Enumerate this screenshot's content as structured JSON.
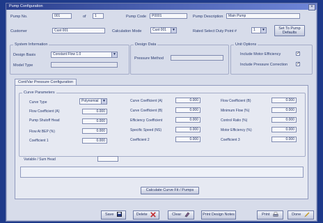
{
  "window": {
    "title": "Pump Configuration",
    "close_glyph": "×"
  },
  "header": {
    "pump_no_label": "Pump No.",
    "pump_no_value": "001",
    "of_label": "of",
    "of_value": "1",
    "pump_code_label": "Pump Code",
    "pump_code_value": "P0001",
    "pump_desc_label": "Pump Description",
    "pump_desc_value": "Main Pump",
    "customer_label": "Customer",
    "customer_value": "Cust 001",
    "calc_mode_label": "Calculation Mode",
    "calc_mode_value": "Cust 001",
    "rated_select_label": "Rated Select Duty Point  #",
    "rated_select_value": "1",
    "set_pump_button": "Set To Pump Defaults"
  },
  "system_info": {
    "title": "System Information",
    "design_basis_label": "Design Basis",
    "design_basis_value": "Constant Flow 1.0",
    "model_type_label": "Model Type",
    "model_type_value": ""
  },
  "design_data": {
    "title": "Design Data",
    "pressure_method_label": "Pressure Method",
    "pressure_method_value": ""
  },
  "unit_options": {
    "title": "Unit Options",
    "include_motor_label": "Include Motor Efficiency",
    "include_motor_checked": "✓",
    "include_pressure_label": "Include Pressure Correction",
    "include_pressure_checked": "✓"
  },
  "tab": {
    "label": "Cont/Var Pressure Configuration"
  },
  "panel": {
    "group_title": "Curve Parameters",
    "col1": [
      {
        "label": "Curve Type",
        "value": "Polynomial",
        "kind": "select"
      },
      {
        "label": "Flow Coefficient (A)",
        "value": "0.000"
      },
      {
        "label": "Pump Shutoff Head",
        "value": "0.000"
      },
      {
        "label": "Flow At BEP (%)",
        "value": "0.000"
      },
      {
        "label": "Coefficient 1",
        "value": "0.000"
      }
    ],
    "col2": [
      {
        "label": "Curve Coefficient (A)",
        "value": "0.000"
      },
      {
        "label": "Curve Coefficient (B)",
        "value": "0.000"
      },
      {
        "label": "Efficiency Coefficient",
        "value": "0.000"
      },
      {
        "label": "Specific Speed (NS)",
        "value": "0.000"
      },
      {
        "label": "Coefficient 2",
        "value": "0.000"
      }
    ],
    "col3": [
      {
        "label": "Flow Coefficient (B)",
        "value": "0.000"
      },
      {
        "label": "Minimum Flow (%)",
        "value": "0.000"
      },
      {
        "label": "Control Ratio (%)",
        "value": "0.000"
      },
      {
        "label": "Motor Efficiency (%)",
        "value": "0.000"
      },
      {
        "label": "Coefficient 3",
        "value": "0.000"
      }
    ],
    "variable_label": "Variable / Sum Head",
    "variable_value": "",
    "calc_button": "Calculate Curve Fit / Pumps"
  },
  "bottom_buttons": {
    "save": "Save",
    "delete": "Delete",
    "clear": "Clear",
    "print_design": "Print Design Notes",
    "print": "Print",
    "done": "Done"
  },
  "colors": {
    "titlebar": "#2a3f8e",
    "window": "#d7dcea",
    "accent_red": "#c0282d",
    "accent_yellow": "#e3b21a"
  }
}
